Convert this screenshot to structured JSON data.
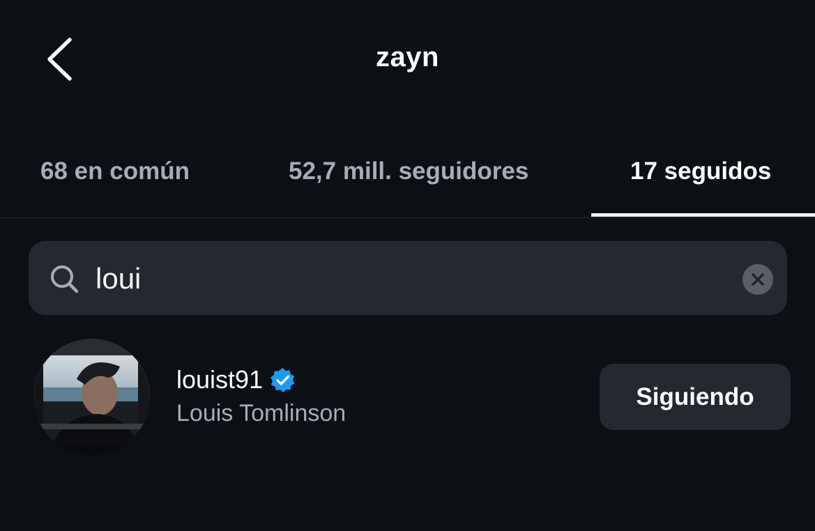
{
  "header": {
    "back_icon": "chevron-left-icon",
    "title": "zayn"
  },
  "tabs": [
    {
      "label": "68 en común",
      "active": false
    },
    {
      "label": "52,7 mill. seguidores",
      "active": false
    },
    {
      "label": "17 seguidos",
      "active": true
    }
  ],
  "search": {
    "icon": "search-icon",
    "value": "loui",
    "clear_icon": "close-icon"
  },
  "results": [
    {
      "username": "louist91",
      "verified": true,
      "full_name": "Louis Tomlinson",
      "follow_label": "Siguiendo"
    }
  ],
  "colors": {
    "background": "#0c0f14",
    "surface": "#25282f",
    "secondary_text": "#a8acb5",
    "verified_blue": "#1d9bf0"
  }
}
